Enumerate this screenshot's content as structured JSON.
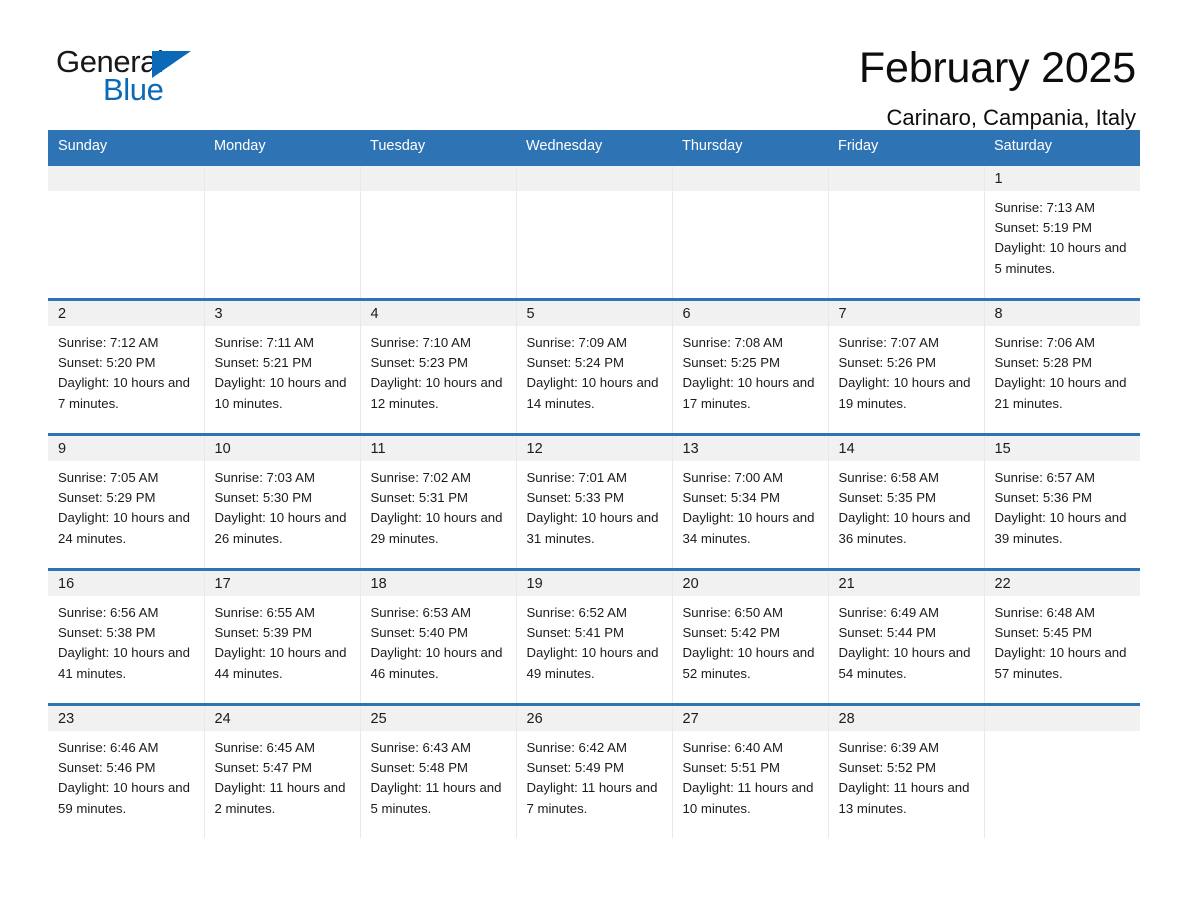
{
  "brand": {
    "name_part1": "General",
    "name_part2": "Blue",
    "triangle_color": "#0b6ab8"
  },
  "header": {
    "title": "February 2025",
    "subtitle": "Carinaro, Campania, Italy"
  },
  "theme": {
    "header_blue": "#2e74b5",
    "daynum_band": "#f1f1f1",
    "text": "#1b1b1b"
  },
  "weekday_headers": [
    "Sunday",
    "Monday",
    "Tuesday",
    "Wednesday",
    "Thursday",
    "Friday",
    "Saturday"
  ],
  "weeks": [
    [
      {
        "day": "",
        "sunrise": "",
        "sunset": "",
        "daylight": "",
        "empty": true
      },
      {
        "day": "",
        "sunrise": "",
        "sunset": "",
        "daylight": "",
        "empty": true
      },
      {
        "day": "",
        "sunrise": "",
        "sunset": "",
        "daylight": "",
        "empty": true
      },
      {
        "day": "",
        "sunrise": "",
        "sunset": "",
        "daylight": "",
        "empty": true
      },
      {
        "day": "",
        "sunrise": "",
        "sunset": "",
        "daylight": "",
        "empty": true
      },
      {
        "day": "",
        "sunrise": "",
        "sunset": "",
        "daylight": "",
        "empty": true
      },
      {
        "day": "1",
        "sunrise": "Sunrise: 7:13 AM",
        "sunset": "Sunset: 5:19 PM",
        "daylight": "Daylight: 10 hours and 5 minutes.",
        "empty": false
      }
    ],
    [
      {
        "day": "2",
        "sunrise": "Sunrise: 7:12 AM",
        "sunset": "Sunset: 5:20 PM",
        "daylight": "Daylight: 10 hours and 7 minutes.",
        "empty": false
      },
      {
        "day": "3",
        "sunrise": "Sunrise: 7:11 AM",
        "sunset": "Sunset: 5:21 PM",
        "daylight": "Daylight: 10 hours and 10 minutes.",
        "empty": false
      },
      {
        "day": "4",
        "sunrise": "Sunrise: 7:10 AM",
        "sunset": "Sunset: 5:23 PM",
        "daylight": "Daylight: 10 hours and 12 minutes.",
        "empty": false
      },
      {
        "day": "5",
        "sunrise": "Sunrise: 7:09 AM",
        "sunset": "Sunset: 5:24 PM",
        "daylight": "Daylight: 10 hours and 14 minutes.",
        "empty": false
      },
      {
        "day": "6",
        "sunrise": "Sunrise: 7:08 AM",
        "sunset": "Sunset: 5:25 PM",
        "daylight": "Daylight: 10 hours and 17 minutes.",
        "empty": false
      },
      {
        "day": "7",
        "sunrise": "Sunrise: 7:07 AM",
        "sunset": "Sunset: 5:26 PM",
        "daylight": "Daylight: 10 hours and 19 minutes.",
        "empty": false
      },
      {
        "day": "8",
        "sunrise": "Sunrise: 7:06 AM",
        "sunset": "Sunset: 5:28 PM",
        "daylight": "Daylight: 10 hours and 21 minutes.",
        "empty": false
      }
    ],
    [
      {
        "day": "9",
        "sunrise": "Sunrise: 7:05 AM",
        "sunset": "Sunset: 5:29 PM",
        "daylight": "Daylight: 10 hours and 24 minutes.",
        "empty": false
      },
      {
        "day": "10",
        "sunrise": "Sunrise: 7:03 AM",
        "sunset": "Sunset: 5:30 PM",
        "daylight": "Daylight: 10 hours and 26 minutes.",
        "empty": false
      },
      {
        "day": "11",
        "sunrise": "Sunrise: 7:02 AM",
        "sunset": "Sunset: 5:31 PM",
        "daylight": "Daylight: 10 hours and 29 minutes.",
        "empty": false
      },
      {
        "day": "12",
        "sunrise": "Sunrise: 7:01 AM",
        "sunset": "Sunset: 5:33 PM",
        "daylight": "Daylight: 10 hours and 31 minutes.",
        "empty": false
      },
      {
        "day": "13",
        "sunrise": "Sunrise: 7:00 AM",
        "sunset": "Sunset: 5:34 PM",
        "daylight": "Daylight: 10 hours and 34 minutes.",
        "empty": false
      },
      {
        "day": "14",
        "sunrise": "Sunrise: 6:58 AM",
        "sunset": "Sunset: 5:35 PM",
        "daylight": "Daylight: 10 hours and 36 minutes.",
        "empty": false
      },
      {
        "day": "15",
        "sunrise": "Sunrise: 6:57 AM",
        "sunset": "Sunset: 5:36 PM",
        "daylight": "Daylight: 10 hours and 39 minutes.",
        "empty": false
      }
    ],
    [
      {
        "day": "16",
        "sunrise": "Sunrise: 6:56 AM",
        "sunset": "Sunset: 5:38 PM",
        "daylight": "Daylight: 10 hours and 41 minutes.",
        "empty": false
      },
      {
        "day": "17",
        "sunrise": "Sunrise: 6:55 AM",
        "sunset": "Sunset: 5:39 PM",
        "daylight": "Daylight: 10 hours and 44 minutes.",
        "empty": false
      },
      {
        "day": "18",
        "sunrise": "Sunrise: 6:53 AM",
        "sunset": "Sunset: 5:40 PM",
        "daylight": "Daylight: 10 hours and 46 minutes.",
        "empty": false
      },
      {
        "day": "19",
        "sunrise": "Sunrise: 6:52 AM",
        "sunset": "Sunset: 5:41 PM",
        "daylight": "Daylight: 10 hours and 49 minutes.",
        "empty": false
      },
      {
        "day": "20",
        "sunrise": "Sunrise: 6:50 AM",
        "sunset": "Sunset: 5:42 PM",
        "daylight": "Daylight: 10 hours and 52 minutes.",
        "empty": false
      },
      {
        "day": "21",
        "sunrise": "Sunrise: 6:49 AM",
        "sunset": "Sunset: 5:44 PM",
        "daylight": "Daylight: 10 hours and 54 minutes.",
        "empty": false
      },
      {
        "day": "22",
        "sunrise": "Sunrise: 6:48 AM",
        "sunset": "Sunset: 5:45 PM",
        "daylight": "Daylight: 10 hours and 57 minutes.",
        "empty": false
      }
    ],
    [
      {
        "day": "23",
        "sunrise": "Sunrise: 6:46 AM",
        "sunset": "Sunset: 5:46 PM",
        "daylight": "Daylight: 10 hours and 59 minutes.",
        "empty": false
      },
      {
        "day": "24",
        "sunrise": "Sunrise: 6:45 AM",
        "sunset": "Sunset: 5:47 PM",
        "daylight": "Daylight: 11 hours and 2 minutes.",
        "empty": false
      },
      {
        "day": "25",
        "sunrise": "Sunrise: 6:43 AM",
        "sunset": "Sunset: 5:48 PM",
        "daylight": "Daylight: 11 hours and 5 minutes.",
        "empty": false
      },
      {
        "day": "26",
        "sunrise": "Sunrise: 6:42 AM",
        "sunset": "Sunset: 5:49 PM",
        "daylight": "Daylight: 11 hours and 7 minutes.",
        "empty": false
      },
      {
        "day": "27",
        "sunrise": "Sunrise: 6:40 AM",
        "sunset": "Sunset: 5:51 PM",
        "daylight": "Daylight: 11 hours and 10 minutes.",
        "empty": false
      },
      {
        "day": "28",
        "sunrise": "Sunrise: 6:39 AM",
        "sunset": "Sunset: 5:52 PM",
        "daylight": "Daylight: 11 hours and 13 minutes.",
        "empty": false
      },
      {
        "day": "",
        "sunrise": "",
        "sunset": "",
        "daylight": "",
        "empty": true
      }
    ]
  ]
}
